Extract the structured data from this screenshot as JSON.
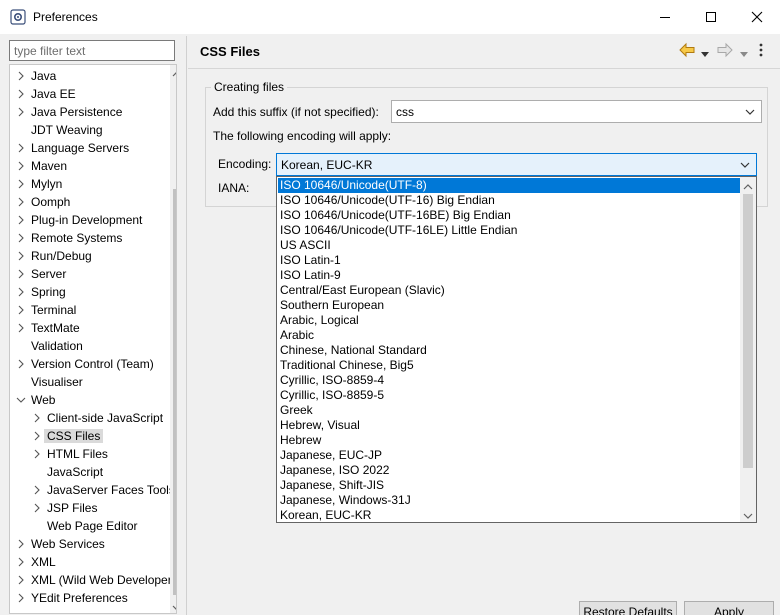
{
  "window": {
    "title": "Preferences"
  },
  "filter": {
    "placeholder": "type filter text"
  },
  "tree": {
    "items": [
      {
        "label": "Java",
        "level": 0,
        "arrow": "collapsed"
      },
      {
        "label": "Java EE",
        "level": 0,
        "arrow": "collapsed"
      },
      {
        "label": "Java Persistence",
        "level": 0,
        "arrow": "collapsed"
      },
      {
        "label": "JDT Weaving",
        "level": 0,
        "arrow": "none"
      },
      {
        "label": "Language Servers",
        "level": 0,
        "arrow": "collapsed"
      },
      {
        "label": "Maven",
        "level": 0,
        "arrow": "collapsed"
      },
      {
        "label": "Mylyn",
        "level": 0,
        "arrow": "collapsed"
      },
      {
        "label": "Oomph",
        "level": 0,
        "arrow": "collapsed"
      },
      {
        "label": "Plug-in Development",
        "level": 0,
        "arrow": "collapsed"
      },
      {
        "label": "Remote Systems",
        "level": 0,
        "arrow": "collapsed"
      },
      {
        "label": "Run/Debug",
        "level": 0,
        "arrow": "collapsed"
      },
      {
        "label": "Server",
        "level": 0,
        "arrow": "collapsed"
      },
      {
        "label": "Spring",
        "level": 0,
        "arrow": "collapsed"
      },
      {
        "label": "Terminal",
        "level": 0,
        "arrow": "collapsed"
      },
      {
        "label": "TextMate",
        "level": 0,
        "arrow": "collapsed"
      },
      {
        "label": "Validation",
        "level": 0,
        "arrow": "none"
      },
      {
        "label": "Version Control (Team)",
        "level": 0,
        "arrow": "collapsed"
      },
      {
        "label": "Visualiser",
        "level": 0,
        "arrow": "none"
      },
      {
        "label": "Web",
        "level": 0,
        "arrow": "expanded"
      },
      {
        "label": "Client-side JavaScript",
        "level": 1,
        "arrow": "collapsed"
      },
      {
        "label": "CSS Files",
        "level": 1,
        "arrow": "collapsed",
        "selected": true
      },
      {
        "label": "HTML Files",
        "level": 1,
        "arrow": "collapsed"
      },
      {
        "label": "JavaScript",
        "level": 1,
        "arrow": "none"
      },
      {
        "label": "JavaServer Faces Tools",
        "level": 1,
        "arrow": "collapsed"
      },
      {
        "label": "JSP Files",
        "level": 1,
        "arrow": "collapsed"
      },
      {
        "label": "Web Page Editor",
        "level": 1,
        "arrow": "none"
      },
      {
        "label": "Web Services",
        "level": 0,
        "arrow": "collapsed"
      },
      {
        "label": "XML",
        "level": 0,
        "arrow": "collapsed"
      },
      {
        "label": "XML (Wild Web Developer)",
        "level": 0,
        "arrow": "collapsed"
      },
      {
        "label": "YEdit Preferences",
        "level": 0,
        "arrow": "collapsed"
      }
    ]
  },
  "page": {
    "title": "CSS Files",
    "group_title": "Creating files",
    "suffix_label": "Add this suffix (if not specified):",
    "suffix_value": "css",
    "encoding_note": "The following encoding will apply:",
    "encoding_label": "Encoding:",
    "encoding_value": "Korean, EUC-KR",
    "iana_label": "IANA:"
  },
  "encoding_options": [
    "ISO 10646/Unicode(UTF-8)",
    "ISO 10646/Unicode(UTF-16) Big Endian",
    "ISO 10646/Unicode(UTF-16BE) Big Endian",
    "ISO 10646/Unicode(UTF-16LE) Little Endian",
    "US ASCII",
    "ISO Latin-1",
    "ISO Latin-9",
    "Central/East European (Slavic)",
    "Southern European",
    "Arabic, Logical",
    "Arabic",
    "Chinese, National Standard",
    "Traditional Chinese, Big5",
    "Cyrillic, ISO-8859-4",
    "Cyrillic, ISO-8859-5",
    "Greek",
    "Hebrew, Visual",
    "Hebrew",
    "Japanese, EUC-JP",
    "Japanese, ISO 2022",
    "Japanese, Shift-JIS",
    "Japanese, Windows-31J",
    "Korean, EUC-KR"
  ],
  "highlighted_option": "ISO 10646/Unicode(UTF-8)",
  "buttons": {
    "restore": "Restore Defaults",
    "apply": "Apply"
  },
  "icons": {
    "app": "preferences-gear-icon",
    "back": "back-arrow-icon",
    "forward": "forward-arrow-icon",
    "menu": "view-menu-icon"
  },
  "colors": {
    "selection": "#0078d7",
    "back_arrow": "#e8a317"
  }
}
